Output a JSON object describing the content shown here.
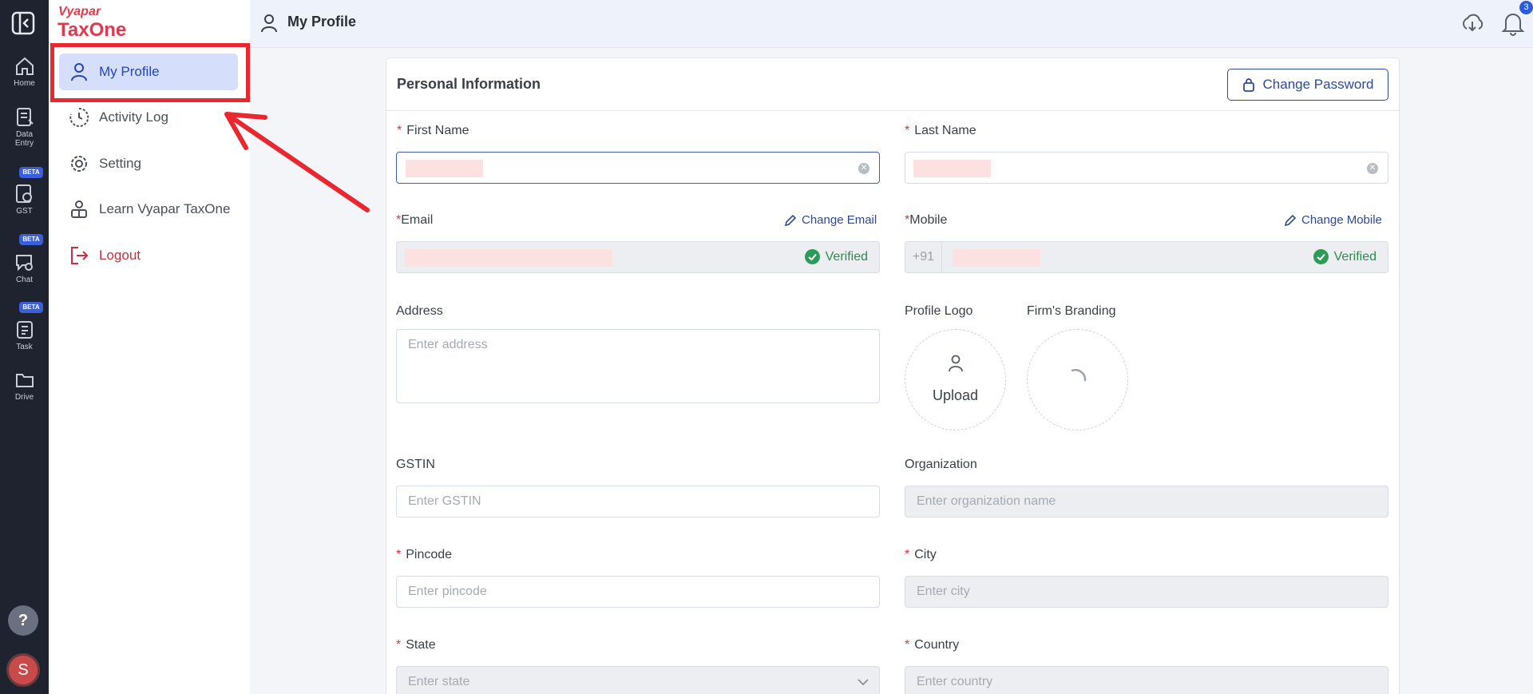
{
  "rail": {
    "items": [
      {
        "label": "Home",
        "icon": "home-icon"
      },
      {
        "label": "Data Entry",
        "icon": "data-entry-icon"
      },
      {
        "label": "GST",
        "icon": "gst-icon",
        "badge": "BETA"
      },
      {
        "label": "Chat",
        "icon": "chat-icon",
        "badge": "BETA"
      },
      {
        "label": "Task",
        "icon": "task-icon",
        "badge": "BETA"
      },
      {
        "label": "Drive",
        "icon": "folder-icon"
      }
    ],
    "help": "?",
    "avatar": "S",
    "labels": {
      "data_line1": "Data",
      "data_line2": "Entry"
    }
  },
  "brand": {
    "top": "Vyapar",
    "main": "TaxOne",
    "color": "#e03a4f"
  },
  "menu": {
    "items": [
      {
        "label": "My Profile",
        "icon": "user-icon",
        "active": true
      },
      {
        "label": "Activity Log",
        "icon": "clock-icon"
      },
      {
        "label": "Setting",
        "icon": "gear-icon"
      },
      {
        "label": "Learn Vyapar TaxOne",
        "icon": "learn-icon"
      },
      {
        "label": "Logout",
        "icon": "logout-icon"
      }
    ]
  },
  "header": {
    "title": "My Profile",
    "notification_count": "3"
  },
  "card": {
    "title": "Personal Information",
    "change_password": "Change Password"
  },
  "form": {
    "first_name": {
      "label": "First Name",
      "required": "*"
    },
    "last_name": {
      "label": "Last Name",
      "required": "*"
    },
    "email": {
      "label": "Email",
      "required": "*",
      "action": "Change Email",
      "status": "Verified"
    },
    "mobile": {
      "label": "Mobile",
      "required": "*",
      "action": "Change Mobile",
      "status": "Verified",
      "prefix": "+91"
    },
    "address": {
      "label": "Address",
      "placeholder": "Enter address"
    },
    "profile_logo": {
      "label": "Profile Logo",
      "action": "Upload"
    },
    "firm_branding": {
      "label": "Firm's Branding"
    },
    "gstin": {
      "label": "GSTIN",
      "placeholder": "Enter GSTIN"
    },
    "organization": {
      "label": "Organization",
      "placeholder": "Enter organization name"
    },
    "pincode": {
      "label": "Pincode",
      "required": "*",
      "placeholder": "Enter pincode"
    },
    "city": {
      "label": "City",
      "required": "*",
      "placeholder": "Enter city"
    },
    "state": {
      "label": "State",
      "required": "*",
      "placeholder": "Enter state"
    },
    "country": {
      "label": "Country",
      "required": "*",
      "placeholder": "Enter country"
    }
  },
  "colors": {
    "accent": "#2d4a99",
    "required": "#d9343f",
    "verified": "#2d8b4e",
    "highlight": "#e8272f"
  }
}
